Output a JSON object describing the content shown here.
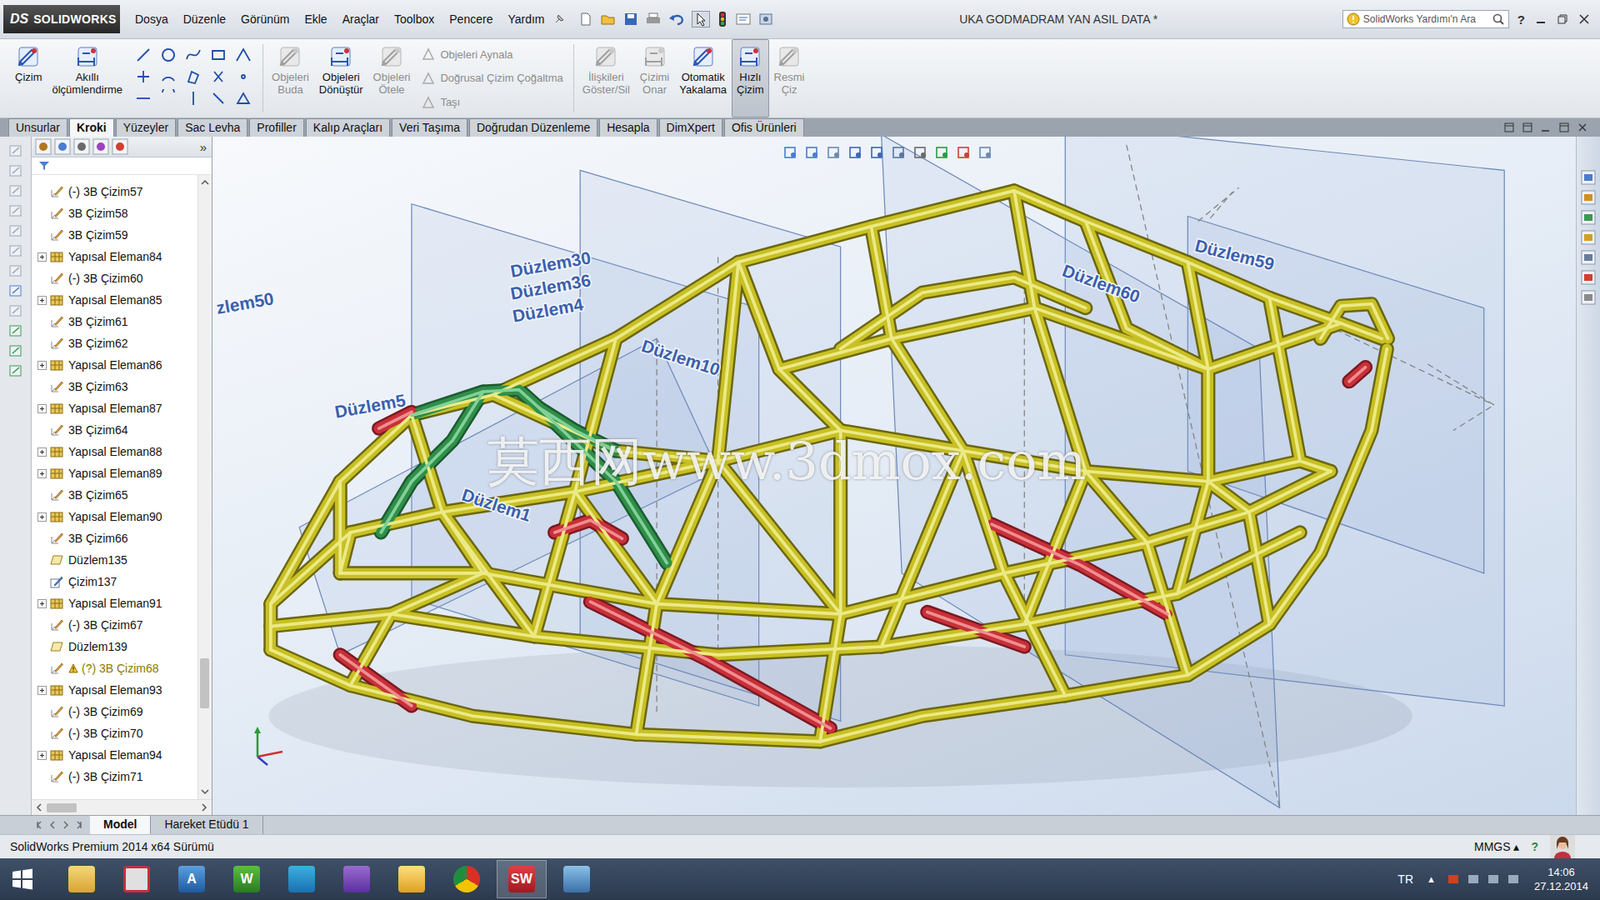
{
  "window": {
    "title": "UKA GODMADRAM YAN ASIL DATA *"
  },
  "logo": {
    "mark": "DS",
    "text": "SOLIDWORKS"
  },
  "menu": [
    "Dosya",
    "Düzenle",
    "Görünüm",
    "Ekle",
    "Araçlar",
    "Toolbox",
    "Pencere",
    "Yardım"
  ],
  "search": {
    "placeholder": "SolidWorks Yardımı'n Ara"
  },
  "help_glyph": "?",
  "ribbon": {
    "sketch_buttons": [
      {
        "lines": [
          "Çizim"
        ],
        "disabled": false,
        "selected": false
      },
      {
        "lines": [
          "Akıllı",
          "ölçümlendirme"
        ],
        "disabled": false,
        "selected": false
      }
    ],
    "edit_buttons": [
      {
        "lines": [
          "Objeleri",
          "Buda"
        ],
        "disabled": true,
        "selected": false
      },
      {
        "lines": [
          "Objeleri",
          "Dönüştür"
        ],
        "disabled": false,
        "selected": false
      },
      {
        "lines": [
          "Objeleri",
          "Ötele"
        ],
        "disabled": true,
        "selected": false
      }
    ],
    "stack": [
      {
        "label": "Objeleri Aynala",
        "disabled": true
      },
      {
        "label": "Doğrusal Çizim Çoğaltma",
        "disabled": true
      },
      {
        "label": "Taşı",
        "disabled": true
      }
    ],
    "tool_buttons": [
      {
        "lines": [
          "İlişkileri",
          "Göster/Sil"
        ],
        "disabled": true,
        "selected": false
      },
      {
        "lines": [
          "Çizimi",
          "Onar"
        ],
        "disabled": true,
        "selected": false
      },
      {
        "lines": [
          "Otomatik",
          "Yakalama"
        ],
        "disabled": false,
        "selected": false
      },
      {
        "lines": [
          "Hızlı",
          "Çizim"
        ],
        "disabled": false,
        "selected": true
      },
      {
        "lines": [
          "Resmi",
          "Çiz"
        ],
        "disabled": true,
        "selected": false
      }
    ]
  },
  "command_tabs": [
    {
      "label": "Unsurlar",
      "selected": false
    },
    {
      "label": "Kroki",
      "selected": true
    },
    {
      "label": "Yüzeyler",
      "selected": false
    },
    {
      "label": "Sac Levha",
      "selected": false
    },
    {
      "label": "Profiller",
      "selected": false
    },
    {
      "label": "Kalıp Araçları",
      "selected": false
    },
    {
      "label": "Veri Taşıma",
      "selected": false
    },
    {
      "label": "Doğrudan Düzenleme",
      "selected": false
    },
    {
      "label": "Hesapla",
      "selected": false
    },
    {
      "label": "DimXpert",
      "selected": false
    },
    {
      "label": "Ofis Ürünleri",
      "selected": false
    }
  ],
  "panel_more": "»",
  "feature_tree": {
    "scroll_level": 0.9,
    "items": [
      {
        "label": "(-) 3B Çizim57",
        "kind": "sketch3d",
        "expandable": false,
        "warning": false
      },
      {
        "label": "3B Çizim58",
        "kind": "sketch3d",
        "expandable": false,
        "warning": false
      },
      {
        "label": "3B Çizim59",
        "kind": "sketch3d",
        "expandable": false,
        "warning": false
      },
      {
        "label": "Yapısal Eleman84",
        "kind": "struct",
        "expandable": true,
        "warning": false
      },
      {
        "label": "(-) 3B Çizim60",
        "kind": "sketch3d",
        "expandable": false,
        "warning": false
      },
      {
        "label": "Yapısal Eleman85",
        "kind": "struct",
        "expandable": true,
        "warning": false
      },
      {
        "label": "3B Çizim61",
        "kind": "sketch3d",
        "expandable": false,
        "warning": false
      },
      {
        "label": "3B Çizim62",
        "kind": "sketch3d",
        "expandable": false,
        "warning": false
      },
      {
        "label": "Yapısal Eleman86",
        "kind": "struct",
        "expandable": true,
        "warning": false
      },
      {
        "label": "3B Çizim63",
        "kind": "sketch3d",
        "expandable": false,
        "warning": false
      },
      {
        "label": "Yapısal Eleman87",
        "kind": "struct",
        "expandable": true,
        "warning": false
      },
      {
        "label": "3B Çizim64",
        "kind": "sketch3d",
        "expandable": false,
        "warning": false
      },
      {
        "label": "Yapısal Eleman88",
        "kind": "struct",
        "expandable": true,
        "warning": false
      },
      {
        "label": "Yapısal Eleman89",
        "kind": "struct",
        "expandable": true,
        "warning": false
      },
      {
        "label": "3B Çizim65",
        "kind": "sketch3d",
        "expandable": false,
        "warning": false
      },
      {
        "label": "Yapısal Eleman90",
        "kind": "struct",
        "expandable": true,
        "warning": false
      },
      {
        "label": "3B Çizim66",
        "kind": "sketch3d",
        "expandable": false,
        "warning": false
      },
      {
        "label": "Düzlem135",
        "kind": "plane",
        "expandable": false,
        "warning": false
      },
      {
        "label": "Çizim137",
        "kind": "sketch",
        "expandable": false,
        "warning": false
      },
      {
        "label": "Yapısal Eleman91",
        "kind": "struct",
        "expandable": true,
        "warning": false
      },
      {
        "label": "(-) 3B Çizim67",
        "kind": "sketch3d",
        "expandable": false,
        "warning": false
      },
      {
        "label": "Düzlem139",
        "kind": "plane",
        "expandable": false,
        "warning": false
      },
      {
        "label": "(?) 3B Çizim68",
        "kind": "sketch3d",
        "expandable": false,
        "warning": true
      },
      {
        "label": "Yapısal Eleman93",
        "kind": "struct",
        "expandable": true,
        "warning": false
      },
      {
        "label": "(-) 3B Çizim69",
        "kind": "sketch3d",
        "expandable": false,
        "warning": false
      },
      {
        "label": "(-) 3B Çizim70",
        "kind": "sketch3d",
        "expandable": false,
        "warning": false
      },
      {
        "label": "Yapısal Eleman94",
        "kind": "struct",
        "expandable": true,
        "warning": false
      },
      {
        "label": "(-) 3B Çizim71",
        "kind": "sketch3d",
        "expandable": false,
        "warning": false
      }
    ]
  },
  "plane_labels": [
    "zlem50",
    "Düzlem5",
    "Düzlem30",
    "Düzlem36",
    "Düzlem4",
    "Düzlem10",
    "Düzlem1",
    "Düzlem60",
    "Düzlem59"
  ],
  "watermark": "莫西网www.3dmox.com",
  "bottom_tabs": [
    {
      "label": "Model",
      "selected": true
    },
    {
      "label": "Hareket Etüdü 1",
      "selected": false
    }
  ],
  "status_bar": {
    "text": "SolidWorks Premium 2014 x64 Sürümü",
    "units": "MMGS",
    "units_arrow": "▴",
    "help": "?"
  },
  "taskbar": {
    "apps": [
      {
        "kind": "explorer",
        "glyph": "",
        "active": false
      },
      {
        "kind": "tasks",
        "glyph": "",
        "active": false
      },
      {
        "kind": "autodesk",
        "glyph": "A",
        "active": false
      },
      {
        "kind": "games",
        "glyph": "W",
        "active": false
      },
      {
        "kind": "photo",
        "glyph": "",
        "active": false
      },
      {
        "kind": "video",
        "glyph": "",
        "active": false
      },
      {
        "kind": "mail",
        "glyph": "",
        "active": false
      },
      {
        "kind": "chrome",
        "glyph": "",
        "active": false
      },
      {
        "kind": "solidworks",
        "glyph": "SW",
        "active": true
      },
      {
        "kind": "viewer",
        "glyph": "",
        "active": false
      }
    ],
    "language": "TR",
    "tray_arrow": "▲",
    "time": "14:06",
    "date": "27.12.2014"
  }
}
